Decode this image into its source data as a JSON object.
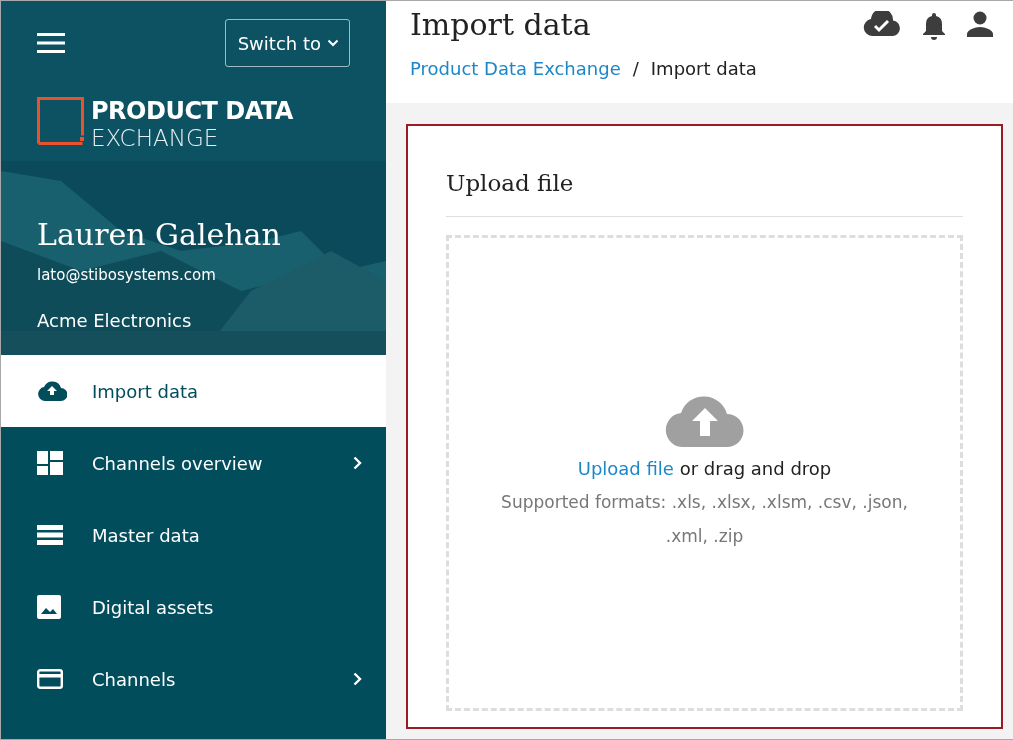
{
  "sidebar": {
    "switch_button": "Switch to",
    "logo": {
      "line_1": "PRODUCT DATA",
      "line_2": "EXCHANGE"
    },
    "user": {
      "name": "Lauren Galehan",
      "email": "lato@stibosystems.com",
      "company": "Acme Electronics"
    },
    "items": [
      {
        "label": "Import data",
        "selected": true,
        "expandable": false
      },
      {
        "label": "Channels overview",
        "selected": false,
        "expandable": true
      },
      {
        "label": "Master data",
        "selected": false,
        "expandable": false
      },
      {
        "label": "Digital assets",
        "selected": false,
        "expandable": false
      },
      {
        "label": "Channels",
        "selected": false,
        "expandable": true
      }
    ]
  },
  "header": {
    "title": "Import data",
    "breadcrumbs": [
      {
        "label": "Product Data Exchange",
        "kind": "link"
      },
      {
        "label": "Import data",
        "kind": "current"
      }
    ],
    "separator": "/"
  },
  "upload": {
    "title": "Upload file",
    "link": "Upload file",
    "text": "or drag and drop",
    "formats": "Supported formats: .xls, .xlsx, .xlsm, .csv, .json, .xml, .zip"
  }
}
